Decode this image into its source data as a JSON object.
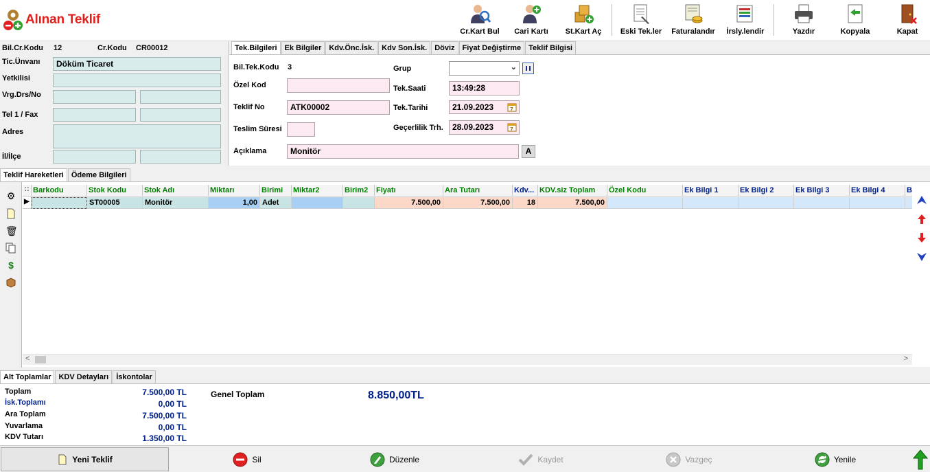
{
  "title": "Alınan Teklif",
  "toolbar": {
    "cr_kart_bul": "Cr.Kart Bul",
    "cari_karti": "Cari Kartı",
    "st_kart_ac": "St.Kart Aç",
    "eski_tekler": "Eski Tek.ler",
    "faturalandir": "Faturalandır",
    "irsalyelendir": "İrsly.lendir",
    "yazdir": "Yazdır",
    "kopyala": "Kopyala",
    "kapat": "Kapat"
  },
  "customer": {
    "bil_cr_kodu_label": "Bil.Cr.Kodu",
    "bil_cr_kodu_value": "12",
    "cr_kodu_label": "Cr.Kodu",
    "cr_kodu_value": "CR00012",
    "tic_unvani_label": "Tic.Ünvanı",
    "tic_unvani_value": "Döküm Ticaret",
    "yetkilisi_label": "Yetkilisi",
    "yetkilisi_value": "",
    "vrg_label": "Vrg.Drs/No",
    "vrg_drs_value": "",
    "vrg_no_value": "",
    "tel_label": "Tel 1 / Fax",
    "tel_value": "",
    "fax_value": "",
    "adres_label": "Adres",
    "adres_value": "",
    "il_ilce_label": "İl/İlçe",
    "il_value": "",
    "ilce_value": ""
  },
  "top_tabs": [
    "Tek.Bilgileri",
    "Ek Bilgiler",
    "Kdv.Önc.İsk.",
    "Kdv Son.İsk.",
    "Döviz",
    "Fiyat Değiştirme",
    "Teklif Bilgisi"
  ],
  "tek": {
    "bil_tek_kodu_label": "Bil.Tek.Kodu",
    "bil_tek_kodu_value": "3",
    "ozel_kod_label": "Özel Kod",
    "ozel_kod_value": "",
    "teklif_no_label": "Teklif No",
    "teklif_no_value": "ATK00002",
    "teslim_suresi_label": "Teslim Süresi",
    "teslim_suresi_value": "",
    "aciklama_label": "Açıklama",
    "aciklama_value": "Monitör",
    "aciklama_btn": "A",
    "grup_label": "Grup",
    "grup_value": "",
    "tek_saati_label": "Tek.Saati",
    "tek_saati_value": "13:49:28",
    "tek_tarihi_label": "Tek.Tarihi",
    "tek_tarihi_value": "21.09.2023",
    "gecerlilik_label": "Geçerlilik Trh.",
    "gecerlilik_value": "28.09.2023"
  },
  "grid_tabs": [
    "Teklif Hareketleri",
    "Ödeme Bilgileri"
  ],
  "grid": {
    "columns": [
      "Barkodu",
      "Stok Kodu",
      "Stok Adı",
      "Miktarı",
      "Birimi",
      "Miktar2",
      "Birim2",
      "Fiyatı",
      "Ara Tutarı",
      "Kdv...",
      "KDV.siz Toplam",
      "Özel Kodu",
      "Ek Bilgi 1",
      "Ek Bilgi 2",
      "Ek Bilgi 3",
      "Ek Bilgi 4",
      "B"
    ],
    "rows": [
      [
        "",
        "ST00005",
        "Monitör",
        "1,00",
        "Adet",
        "",
        "",
        "7.500,00",
        "7.500,00",
        "18",
        "7.500,00",
        "",
        "",
        "",
        "",
        "",
        ""
      ]
    ]
  },
  "totals_tabs": [
    "Alt Toplamlar",
    "KDV Detayları",
    "İskontolar"
  ],
  "totals": {
    "toplam_label": "Toplam",
    "toplam_value": "7.500,00 TL",
    "isk_label": "İsk.Toplamı",
    "isk_value": "0,00 TL",
    "ara_label": "Ara Toplam",
    "ara_value": "7.500,00 TL",
    "yuv_label": "Yuvarlama",
    "yuv_value": "0,00 TL",
    "kdv_label": "KDV Tutarı",
    "kdv_value": "1.350,00 TL",
    "genel_label": "Genel Toplam",
    "genel_value": "8.850,00TL"
  },
  "bottom": {
    "yeni_teklif": "Yeni Teklif",
    "sil": "Sil",
    "duzenle": "Düzenle",
    "kaydet": "Kaydet",
    "vazgec": "Vazgeç",
    "yenile": "Yenile"
  },
  "colors": {
    "title": "#e0201c",
    "field_teal": "#d8ecec",
    "field_pink": "#fde9f1",
    "grid_header_green": "#008000",
    "grid_header_blue": "#00208a",
    "total_blue": "#00208a"
  }
}
